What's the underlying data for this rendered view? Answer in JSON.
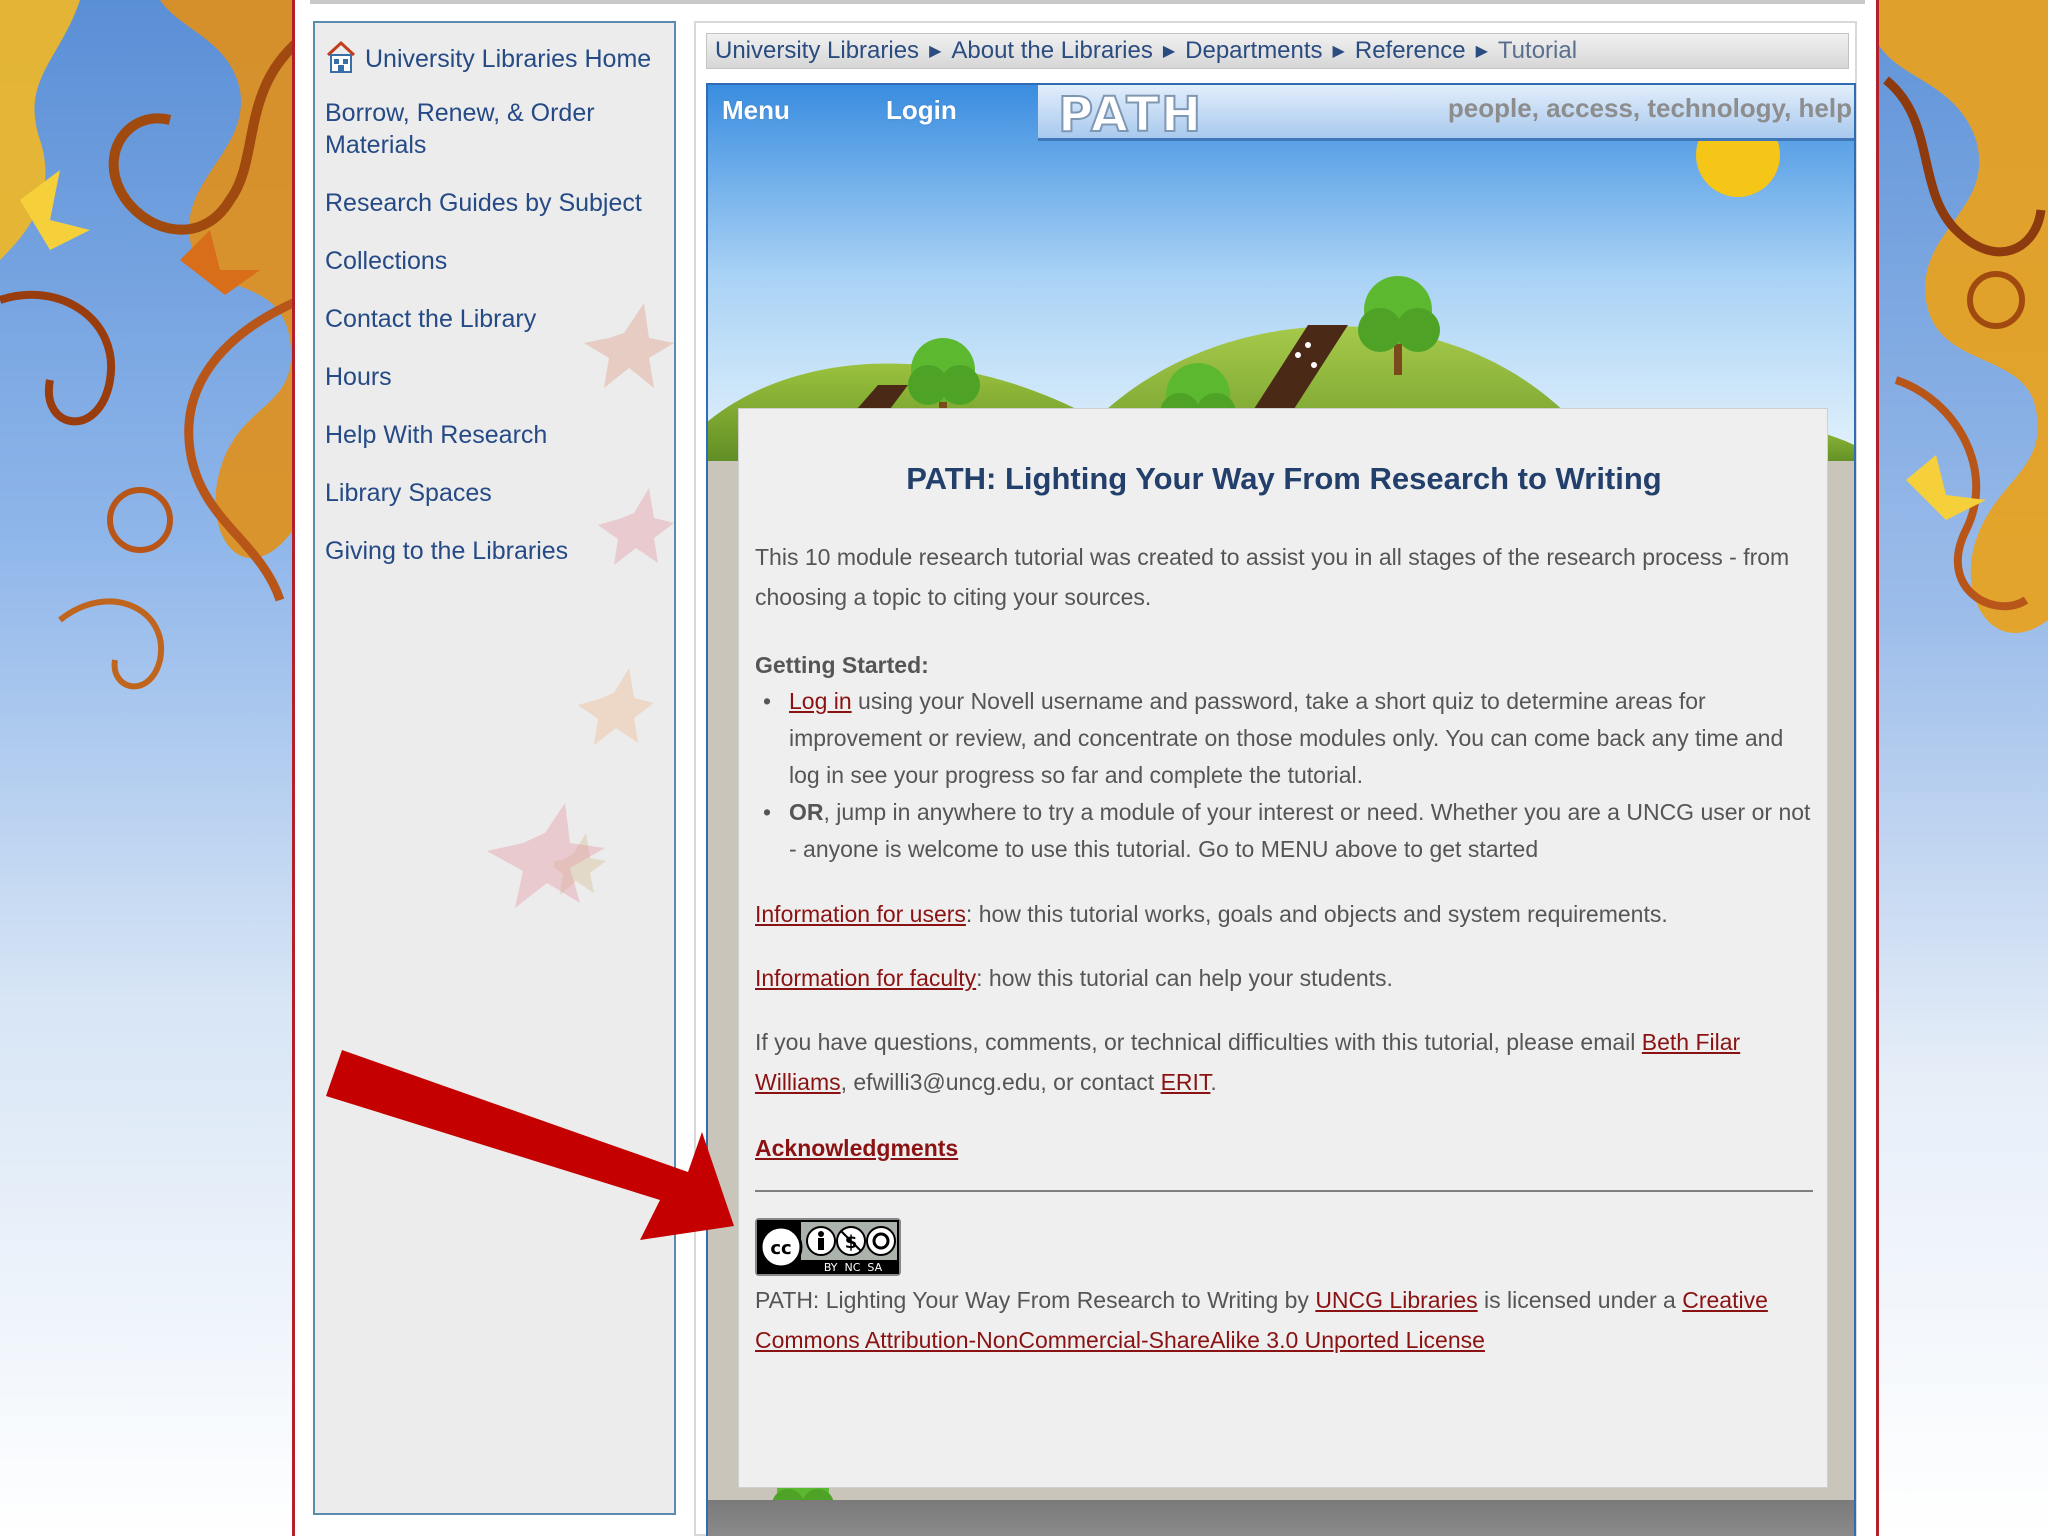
{
  "sidebar": {
    "items": [
      {
        "label": "University Libraries Home"
      },
      {
        "label": "Borrow, Renew, & Order Materials"
      },
      {
        "label": "Research Guides by Subject"
      },
      {
        "label": "Collections"
      },
      {
        "label": "Contact the Library"
      },
      {
        "label": "Hours"
      },
      {
        "label": "Help With Research"
      },
      {
        "label": "Library Spaces"
      },
      {
        "label": "Giving to the Libraries"
      }
    ]
  },
  "breadcrumb": [
    "University Libraries",
    "About the Libraries",
    "Departments",
    "Reference",
    "Tutorial"
  ],
  "nav": {
    "menu": "Menu",
    "login": "Login"
  },
  "banner": {
    "logo": "PATH",
    "tagline": "people, access, technology, help"
  },
  "content": {
    "title": "PATH: Lighting Your Way From Research to Writing",
    "intro": "This 10 module research tutorial was created to assist you in all stages of the research process - from choosing a topic to citing your sources.",
    "getting_started": "Getting Started:",
    "item1_link": "Log in",
    "item1_text": " using your Novell username and password, take a short quiz to determine areas for improvement or review, and concentrate on those modules only. You can come back any time and log in see your progress so far and complete the tutorial.",
    "item2_bold": "OR",
    "item2_text": ", jump in anywhere to try a module of your interest or need. Whether you are a UNCG user or not - anyone is welcome to use this tutorial. Go to MENU above to get started",
    "info_users_link": "Information for users",
    "info_users_text": ": how this tutorial works, goals and objects and system requirements.",
    "info_faculty_link": "Information for faculty",
    "info_faculty_text": ": how this tutorial can help your students.",
    "contact_pre": "If you have questions, comments, or technical difficulties with this tutorial, please email ",
    "contact_link": "Beth Filar Williams",
    "contact_mid": ", efwilli3@uncg.edu, or contact ",
    "contact_link2": "ERIT",
    "contact_end": ".",
    "acknowledgments": "Acknowledgments",
    "cc_badge": {
      "cc": "cc",
      "labels": "BY  NC  SA"
    },
    "license_pre": "PATH: Lighting Your Way From Research to Writing by ",
    "license_link1": "UNCG Libraries",
    "license_mid": " is licensed under a ",
    "license_link2": "Creative Commons Attribution-NonCommercial-ShareAlike 3.0 Unported License"
  },
  "colors": {
    "link": "#8b1212",
    "nav_text": "#254a85",
    "arrow": "#c00000",
    "frame": "#b4202a"
  }
}
